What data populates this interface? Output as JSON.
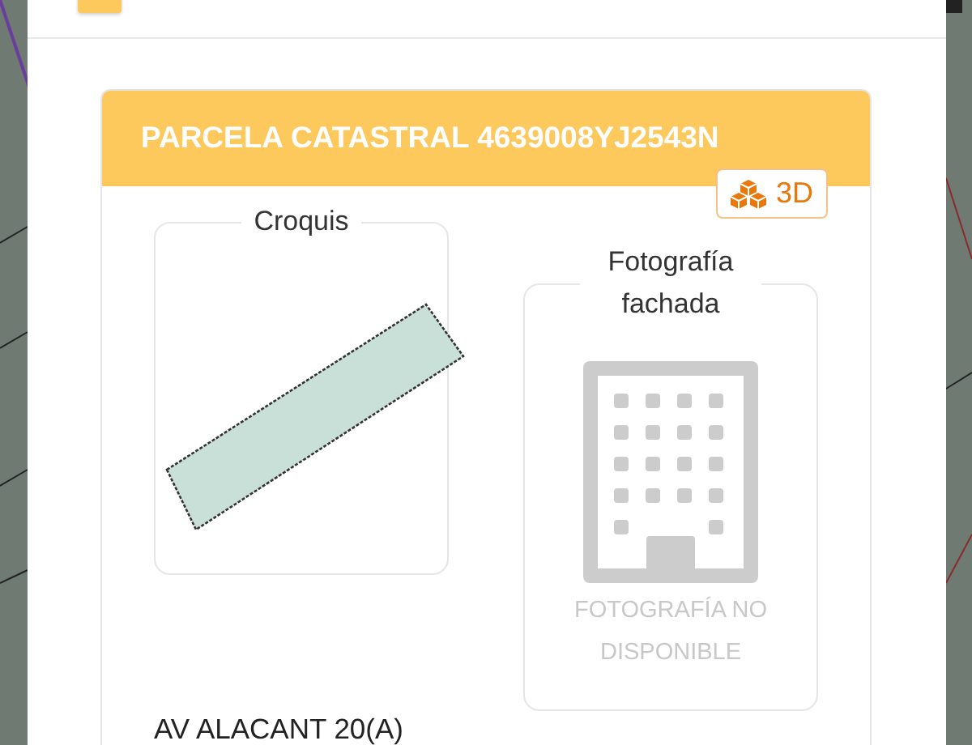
{
  "header": {
    "kind": "square"
  },
  "parcel": {
    "title": "PARCELA CATASTRAL 4639008YJ2543N",
    "view_button": "3D",
    "sketch": {
      "label": "Croquis"
    },
    "photo": {
      "label": "Fotografía fachada",
      "message": "FOTOGRAFÍA NO DISPONIBLE"
    },
    "address": "AV ALACANT 20(A)"
  }
}
